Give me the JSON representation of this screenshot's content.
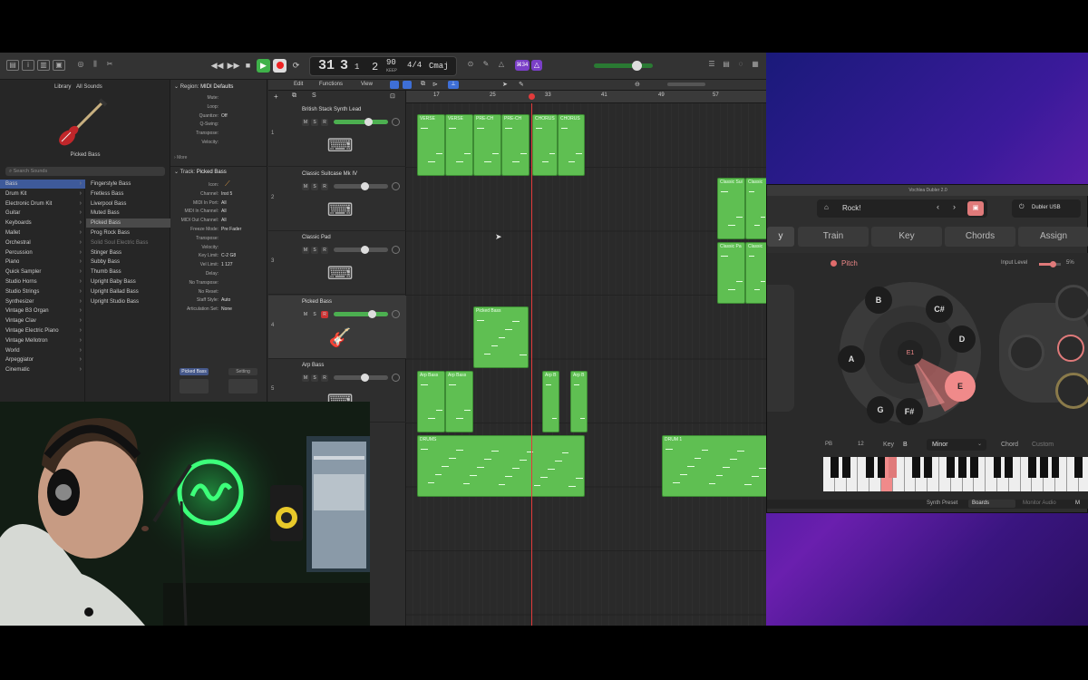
{
  "toolbar": {
    "lcd": {
      "bar": "31",
      "beat": "3",
      "div": "1",
      "tick": "2",
      "tempo": "90",
      "tempo_label": "KEEP",
      "sig": "4/4",
      "key": "Cmaj"
    },
    "track_count": "⌘34"
  },
  "library": {
    "title": "Library",
    "scope": "All Sounds",
    "patch_name": "Picked Bass",
    "search_placeholder": "Search Sounds",
    "categories": [
      "Bass",
      "Drum Kit",
      "Electronic Drum Kit",
      "Guitar",
      "Keyboards",
      "Mallet",
      "Orchestral",
      "Percussion",
      "Piano",
      "Quick Sampler",
      "Studio Horns",
      "Studio Strings",
      "Synthesizer",
      "Vintage B3 Organ",
      "Vintage Clav",
      "Vintage Electric Piano",
      "Vintage Mellotron",
      "World",
      "Arpeggiator",
      "Cinematic"
    ],
    "patches": [
      "Fingerstyle Bass",
      "Fretless Bass",
      "Liverpool Bass",
      "Muted Bass",
      "Picked Bass",
      "Prog Rock Bass",
      "Solid Soul Electric Bass",
      "Stinger Bass",
      "Subby Bass",
      "Thumb Bass",
      "Upright Baby Bass",
      "Upright Ballad Bass",
      "Upright Studio Bass"
    ]
  },
  "inspector": {
    "region_label": "Region:",
    "region_name": "MIDI Defaults",
    "region_rows": [
      [
        "Mute:",
        ""
      ],
      [
        "Loop:",
        ""
      ],
      [
        "Quantize:",
        "Off"
      ],
      [
        "Q-Swing:",
        ""
      ],
      [
        "Transpose:",
        ""
      ],
      [
        "Velocity:",
        ""
      ]
    ],
    "more": "More",
    "track_label": "Track:",
    "track_name": "Picked Bass",
    "track_rows": [
      [
        "Icon:",
        ""
      ],
      [
        "Channel:",
        "Inst 5"
      ],
      [
        "MIDI In Port:",
        "All"
      ],
      [
        "MIDI In Channel:",
        "All"
      ],
      [
        "MIDI Out Channel:",
        "All"
      ],
      [
        "Freeze Mode:",
        "Pre Fader"
      ],
      [
        "Transpose:",
        ""
      ],
      [
        "Velocity:",
        ""
      ],
      [
        "Key Limit:",
        "C-2  G8"
      ],
      [
        "Vel Limit:",
        "1  127"
      ],
      [
        "Delay:",
        ""
      ],
      [
        "No Transpose:",
        ""
      ],
      [
        "No Reset:",
        ""
      ],
      [
        "Staff Style:",
        "Auto"
      ],
      [
        "Articulation Set:",
        "None"
      ]
    ],
    "strip_left": "Picked Bass",
    "strip_right": "Setting"
  },
  "arrange": {
    "menus": [
      "Edit",
      "Functions",
      "View"
    ],
    "ruler": [
      "17",
      "25",
      "33",
      "41",
      "49",
      "57"
    ],
    "tracks": [
      {
        "num": "1",
        "name": "British Stack Synth Lead"
      },
      {
        "num": "2",
        "name": "Classic Suitcase Mk IV"
      },
      {
        "num": "3",
        "name": "Classic Pad"
      },
      {
        "num": "4",
        "name": "Picked Bass"
      },
      {
        "num": "5",
        "name": "Arp Bass"
      }
    ],
    "regions": {
      "lead": [
        "VERSE",
        "VERSE",
        "PRE-CH",
        "PRE-CH",
        "CHORUS",
        "CHORUS"
      ],
      "keys": [
        "Classic Sui",
        "Classic"
      ],
      "pad": [
        "Classic Pa",
        "Classic"
      ],
      "bass": "Picked Bass",
      "arp": [
        "Arp Bass",
        "Arp Bass",
        "Arp B",
        "Arp B"
      ],
      "drums": [
        "DRUMS",
        "DRUM 1"
      ]
    }
  },
  "dubler": {
    "title": "Vochlea Dubler 2.0",
    "preset": "Rock!",
    "device": "Dubler USB",
    "tabs": [
      "y",
      "Train",
      "Key",
      "Chords",
      "Assign"
    ],
    "pitch_label": "Pitch",
    "input_level": "Input Level",
    "input_pct": "5%",
    "notes": [
      "B",
      "C#",
      "D",
      "E",
      "F#",
      "G",
      "A"
    ],
    "center_note": "E1",
    "pb_label": "PB",
    "pb_value": "12",
    "key_label": "Key",
    "key_root": "B",
    "key_mode": "Minor",
    "chord_label": "Chord",
    "chord_value": "Custom",
    "synth_preset_label": "Synth Preset",
    "synth_preset": "Boards",
    "footer_a": "Monitor Audio",
    "footer_b": "M"
  },
  "colors": {
    "region_green": "#5fbf52",
    "accent_pink": "#f08a8a",
    "playhead": "#e23b3b"
  }
}
